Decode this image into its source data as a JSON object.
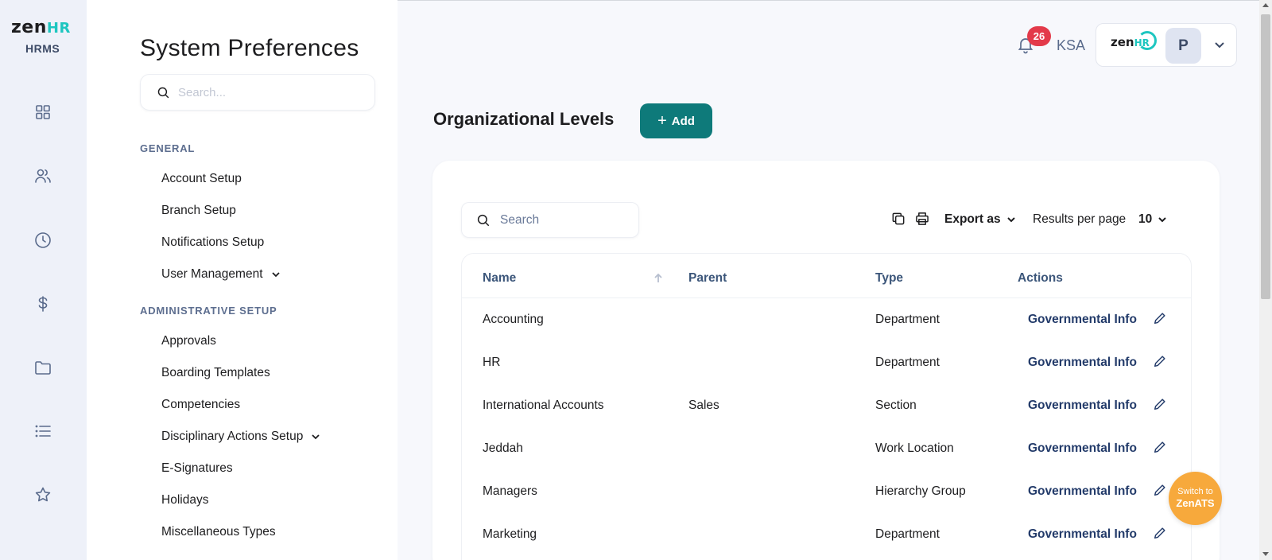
{
  "brand": {
    "logo_zen": "zen",
    "logo_hr": "HR",
    "sub": "HRMS"
  },
  "rail": {
    "icons": [
      "dashboard-icon",
      "people-icon",
      "clock-icon",
      "dollar-icon",
      "folder-icon",
      "list-icon",
      "star-icon"
    ]
  },
  "prefs": {
    "title": "System Preferences",
    "search_placeholder": "Search...",
    "sections": [
      {
        "label": "GENERAL",
        "items": [
          "Account Setup",
          "Branch Setup",
          "Notifications Setup",
          "User Management"
        ]
      },
      {
        "label": "ADMINISTRATIVE SETUP",
        "items": [
          "Approvals",
          "Boarding Templates",
          "Competencies",
          "Disciplinary Actions Setup",
          "E-Signatures",
          "Holidays",
          "Miscellaneous Types"
        ]
      }
    ]
  },
  "header": {
    "notification_count": "26",
    "country": "KSA",
    "account_logo_zen": "zen",
    "account_logo_hr": "HR",
    "avatar_initial": "P"
  },
  "main": {
    "title": "Organizational Levels",
    "add_label": "Add",
    "table_search_placeholder": "Search",
    "export_label": "Export as",
    "results_per_page_label": "Results per page",
    "results_per_page_value": "10",
    "columns": [
      "Name",
      "Parent",
      "Type",
      "Actions"
    ],
    "rows": [
      {
        "name": "Accounting",
        "parent": "",
        "type": "Department",
        "action": "Governmental Info"
      },
      {
        "name": "HR",
        "parent": "",
        "type": "Department",
        "action": "Governmental Info"
      },
      {
        "name": "International Accounts",
        "parent": "Sales",
        "type": "Section",
        "action": "Governmental Info"
      },
      {
        "name": "Jeddah",
        "parent": "",
        "type": "Work Location",
        "action": "Governmental Info"
      },
      {
        "name": "Managers",
        "parent": "",
        "type": "Hierarchy Group",
        "action": "Governmental Info"
      },
      {
        "name": "Marketing",
        "parent": "",
        "type": "Department",
        "action": "Governmental Info"
      }
    ]
  },
  "fab": {
    "line1": "Switch to",
    "line2": "ZenATS"
  },
  "colors": {
    "accent": "#0e7a7a",
    "brand_teal": "#1ec6c0",
    "badge": "#e33a4a",
    "fab": "#f7a93c",
    "link": "#233b6a"
  }
}
